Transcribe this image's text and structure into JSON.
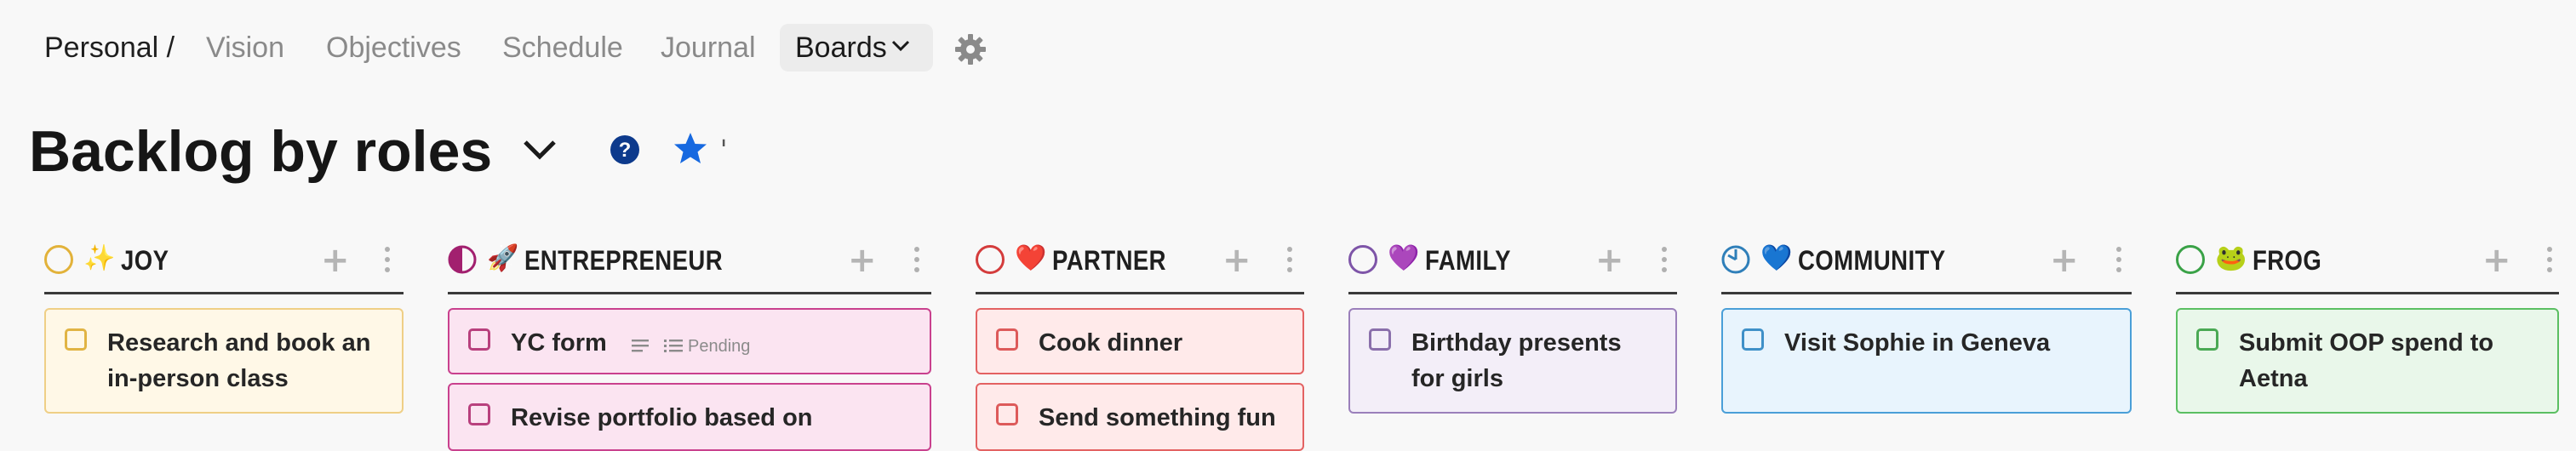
{
  "nav": {
    "crumb": "Personal /",
    "items": [
      "Vision",
      "Objectives",
      "Schedule",
      "Journal"
    ],
    "boards_label": "Boards",
    "settings_icon": "gear-icon"
  },
  "page": {
    "title": "Backlog by roles",
    "tick": "'"
  },
  "columns": [
    {
      "name": "JOY",
      "emoji": "✨",
      "circle_color": "#e2b23a",
      "cards": [
        {
          "text": "Research and book an in-person class",
          "bg": "#fff8e7",
          "border": "#efcf86",
          "check": "#e1b444"
        }
      ]
    },
    {
      "name": "ENTREPRENEUR",
      "emoji": "🚀",
      "circle_color": "#a2206f",
      "cards": [
        {
          "text": "YC form",
          "badge": "Pending",
          "bg": "#fbe4f1",
          "border": "#c9418e",
          "check": "#b8407d"
        },
        {
          "text": "Revise portfolio based on",
          "bg": "#fbe4f1",
          "border": "#c9418e",
          "check": "#b8407d"
        }
      ]
    },
    {
      "name": "PARTNER",
      "emoji": "❤️",
      "circle_color": "#d43c3c",
      "cards": [
        {
          "text": "Cook dinner",
          "bg": "#ffeaea",
          "border": "#e36262",
          "check": "#dd5a5a"
        },
        {
          "text": "Send something fun",
          "bg": "#ffeaea",
          "border": "#e36262",
          "check": "#dd5a5a"
        }
      ]
    },
    {
      "name": "FAMILY",
      "emoji": "💜",
      "circle_color": "#7e55a8",
      "cards": [
        {
          "text": "Birthday presents for girls",
          "bg": "#f3eef8",
          "border": "#9b80bb",
          "check": "#8a6fab"
        }
      ]
    },
    {
      "name": "COMMUNITY",
      "emoji": "💙",
      "circle_color": "#2f7fb9",
      "cards": [
        {
          "text": "Visit Sophie in Geneva",
          "bg": "#e8f4fd",
          "border": "#4a9fd8",
          "check": "#3f90c8"
        }
      ]
    },
    {
      "name": "FROG",
      "emoji": "🐸",
      "circle_color": "#3aa247",
      "cards": [
        {
          "text": "Submit OOP spend to Aetna",
          "bg": "#e9f7ea",
          "border": "#5bbf62",
          "check": "#4aa954"
        }
      ]
    }
  ]
}
